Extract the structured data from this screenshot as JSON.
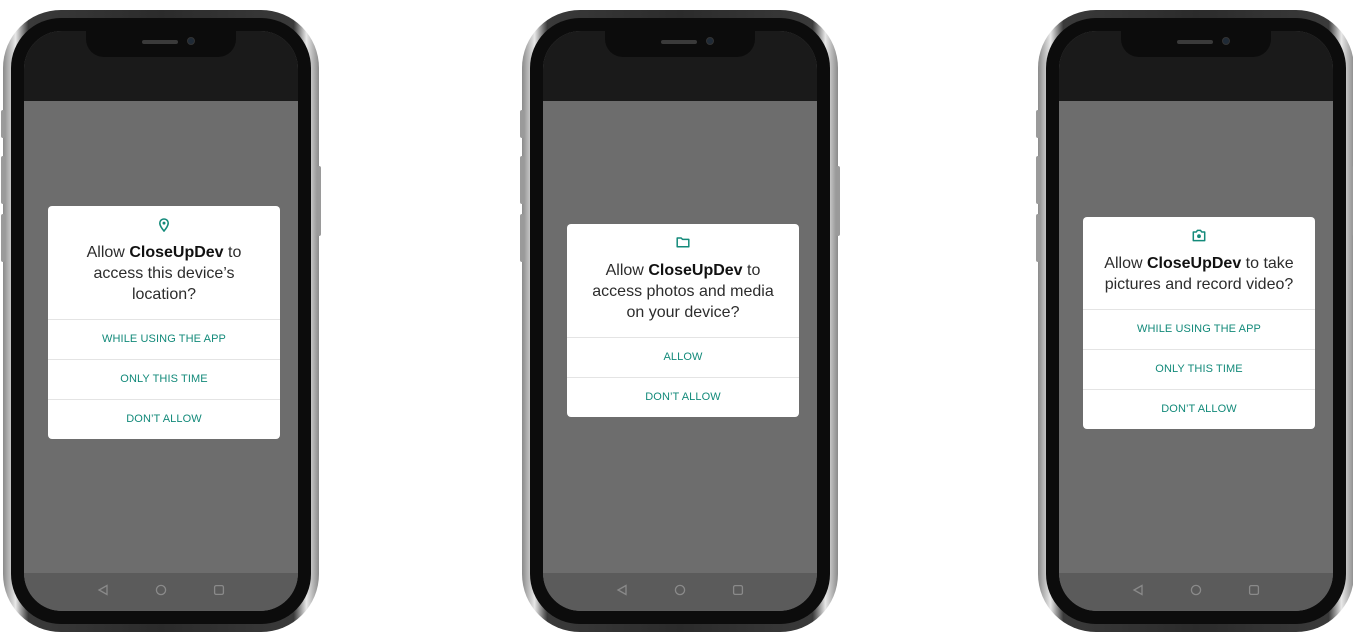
{
  "accent_color": "#138a7a",
  "phones": [
    {
      "icon": "location-pin-icon",
      "title_prefix": "Allow ",
      "app_name": "CloseUpDev",
      "title_suffix": " to access this device’s location?",
      "buttons": [
        "WHILE USING THE APP",
        "ONLY THIS TIME",
        "DON’T ALLOW"
      ]
    },
    {
      "icon": "folder-icon",
      "title_prefix": "Allow ",
      "app_name": "CloseUpDev",
      "title_suffix": " to access photos and media on your device?",
      "buttons": [
        "ALLOW",
        "DON’T ALLOW"
      ]
    },
    {
      "icon": "camera-icon",
      "title_prefix": "Allow ",
      "app_name": "CloseUpDev",
      "title_suffix": " to take pictures and record video?",
      "buttons": [
        "WHILE USING THE APP",
        "ONLY THIS TIME",
        "DON’T ALLOW"
      ]
    }
  ],
  "nav_icons": [
    "back-icon",
    "home-icon",
    "recent-apps-icon"
  ]
}
